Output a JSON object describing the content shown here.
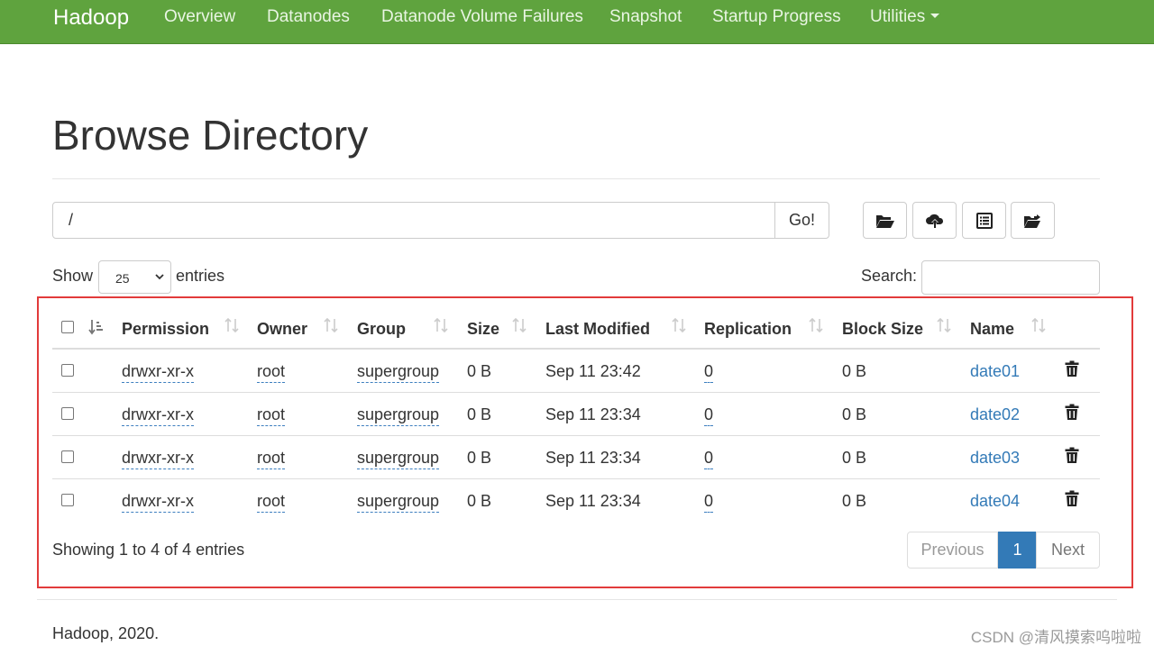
{
  "navbar": {
    "brand": "Hadoop",
    "items": [
      "Overview",
      "Datanodes",
      "Datanode Volume Failures",
      "Snapshot",
      "Startup Progress",
      "Utilities"
    ]
  },
  "page": {
    "title": "Browse Directory"
  },
  "pathbar": {
    "path": "/",
    "go_label": "Go!"
  },
  "toolbar_icons": [
    "folder-open-icon",
    "cloud-upload-icon",
    "list-alt-icon",
    "folder-share-icon"
  ],
  "length": {
    "show_label": "Show",
    "selected": "25",
    "entries_label": "entries"
  },
  "search": {
    "label": "Search:",
    "value": ""
  },
  "table": {
    "headers": [
      "Permission",
      "Owner",
      "Group",
      "Size",
      "Last Modified",
      "Replication",
      "Block Size",
      "Name"
    ],
    "rows": [
      {
        "permission": "drwxr-xr-x",
        "owner": "root",
        "group": "supergroup",
        "size": "0 B",
        "modified": "Sep 11 23:42",
        "replication": "0",
        "block_size": "0 B",
        "name": "date01"
      },
      {
        "permission": "drwxr-xr-x",
        "owner": "root",
        "group": "supergroup",
        "size": "0 B",
        "modified": "Sep 11 23:34",
        "replication": "0",
        "block_size": "0 B",
        "name": "date02"
      },
      {
        "permission": "drwxr-xr-x",
        "owner": "root",
        "group": "supergroup",
        "size": "0 B",
        "modified": "Sep 11 23:34",
        "replication": "0",
        "block_size": "0 B",
        "name": "date03"
      },
      {
        "permission": "drwxr-xr-x",
        "owner": "root",
        "group": "supergroup",
        "size": "0 B",
        "modified": "Sep 11 23:34",
        "replication": "0",
        "block_size": "0 B",
        "name": "date04"
      }
    ]
  },
  "info": "Showing 1 to 4 of 4 entries",
  "pagination": {
    "previous": "Previous",
    "current": "1",
    "next": "Next"
  },
  "footer": "Hadoop, 2020.",
  "watermark": "CSDN @清风摸索呜啦啦",
  "colors": {
    "navbar": "#5fa33e",
    "link": "#337ab7",
    "highlight_box": "#e23b3b",
    "active_page": "#337ab7"
  }
}
